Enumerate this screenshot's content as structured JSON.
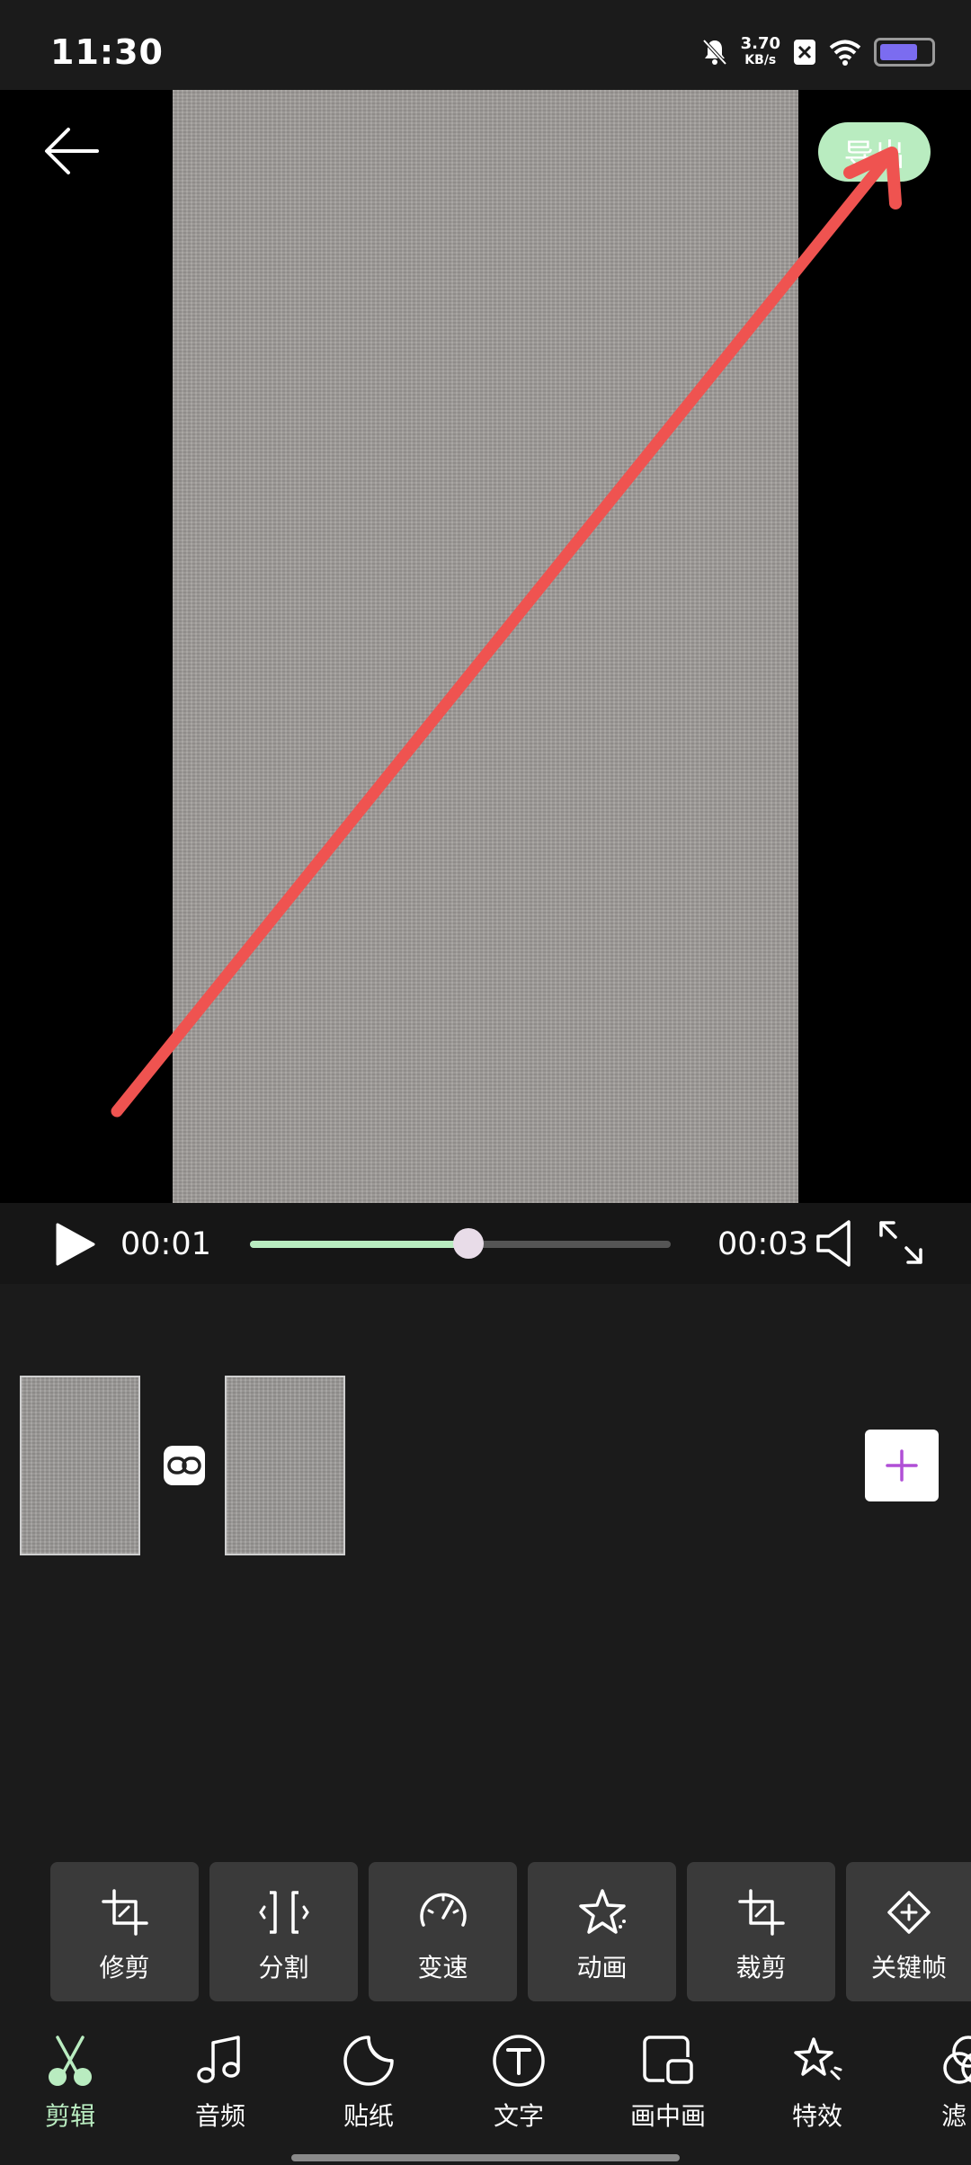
{
  "status_bar": {
    "time": "11:30",
    "net_speed_value": "3.70",
    "net_speed_unit": "KB/s",
    "battery_level": 0.75,
    "icons": [
      "bell-off-icon",
      "no-sim-icon",
      "wifi-icon",
      "battery-icon"
    ]
  },
  "header": {
    "back_icon": "back-arrow-icon",
    "export_label": "导出"
  },
  "player": {
    "current_time": "00:01",
    "total_time": "00:03",
    "progress": 0.52,
    "icons": [
      "play-icon",
      "volume-icon",
      "fullscreen-icon"
    ]
  },
  "timeline": {
    "clips": 2,
    "link_icon": "link-icon",
    "add_icon": "plus-icon"
  },
  "tools": [
    {
      "label": "修剪",
      "icon": "crop-icon"
    },
    {
      "label": "分割",
      "icon": "split-icon"
    },
    {
      "label": "变速",
      "icon": "speedometer-icon"
    },
    {
      "label": "动画",
      "icon": "star-icon"
    },
    {
      "label": "裁剪",
      "icon": "crop-icon"
    },
    {
      "label": "关键帧",
      "icon": "keyframe-icon"
    }
  ],
  "nav": [
    {
      "label": "剪辑",
      "icon": "scissors-icon",
      "active": true
    },
    {
      "label": "音频",
      "icon": "music-note-icon"
    },
    {
      "label": "贴纸",
      "icon": "sticker-icon"
    },
    {
      "label": "文字",
      "icon": "text-icon"
    },
    {
      "label": "画中画",
      "icon": "pip-icon"
    },
    {
      "label": "特效",
      "icon": "sparkle-star-icon"
    },
    {
      "label": "滤",
      "icon": "filter-icon"
    }
  ],
  "colors": {
    "accent": "#b9ecc0",
    "annotation_arrow": "#ef5350",
    "background": "#1b1b1b",
    "add_plus": "#b04fd6"
  }
}
